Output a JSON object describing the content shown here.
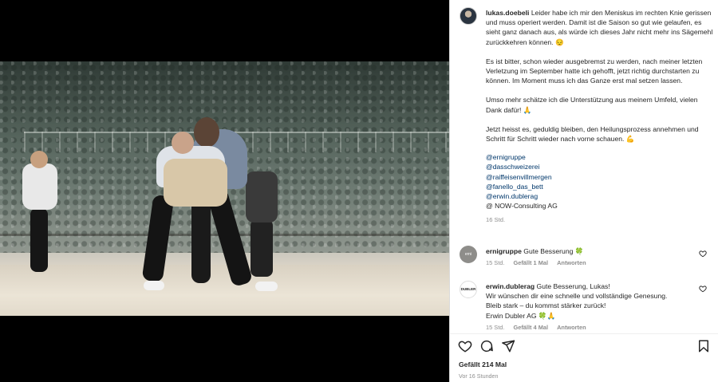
{
  "post": {
    "username": "lukas.doebeli",
    "caption_p1": "Leider habe ich mir den Meniskus im rechten Knie gerissen und muss operiert werden. Damit ist die Saison so gut wie gelaufen, es sieht ganz danach aus, als würde ich dieses Jahr nicht mehr ins Sägemehl zurückkehren können. 😔",
    "caption_p2": "Es ist bitter, schon wieder ausgebremst zu werden, nach meiner letzten Verletzung im September hatte ich gehofft, jetzt richtig durchstarten zu können. Im Moment muss ich das Ganze erst mal setzen lassen.",
    "caption_p3": "Umso mehr schätze ich die Unterstützung aus meinem Umfeld, vielen Dank dafür! 🙏",
    "caption_p4": "Jetzt heisst es, geduldig bleiben, den Heilungsprozess annehmen und Schritt für Schritt wieder nach vorne schauen. 💪",
    "mentions": [
      "@ernigruppe",
      "@dasschweizerei",
      "@raiffeisenvillmergen",
      "@fanello_das_bett",
      "@erwin.dublerag"
    ],
    "plain_mention": "@ NOW-Consulting AG",
    "caption_time": "16 Std."
  },
  "comments": [
    {
      "username": "ernigruppe",
      "avatar_text": "erni",
      "text": "Gute Besserung 🍀",
      "time": "15 Std.",
      "likes": "Gefällt 1 Mal",
      "reply": "Antworten"
    },
    {
      "username": "erwin.dublerag",
      "avatar_text": "DUBLER",
      "text_l1": "Gute Besserung, Lukas!",
      "text_l2": "Wir wünschen dir eine schnelle und vollständige Genesung.",
      "text_l3": "Bleib stark – du kommst stärker zurück!",
      "text_l4": "Erwin Dubler AG 🍀🙏",
      "time": "15 Std.",
      "likes": "Gefällt 4 Mal",
      "reply": "Antworten"
    }
  ],
  "footer": {
    "likes": "Gefällt 214 Mal",
    "posted": "Vor 16 Stunden"
  },
  "icons": {
    "like": "heart-icon",
    "comment": "comment-icon",
    "share": "share-icon",
    "save": "bookmark-icon"
  }
}
